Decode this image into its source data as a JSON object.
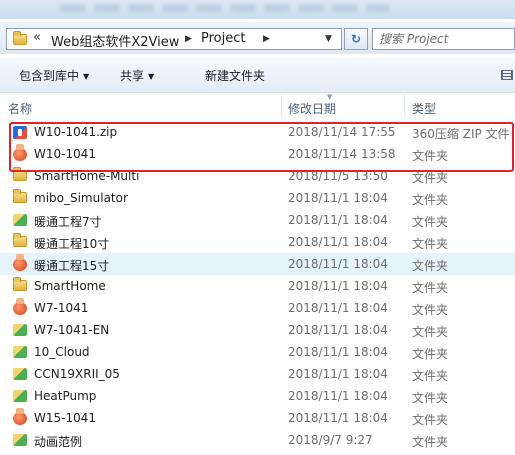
{
  "address": {
    "chevron": "«",
    "crumbs": [
      "Web组态软件X2View",
      "Project"
    ],
    "search_placeholder": "搜索 Project"
  },
  "toolbar": {
    "include_label": "包含到库中",
    "share_label": "共享",
    "new_folder_label": "新建文件夹"
  },
  "columns": {
    "name": "名称",
    "date": "修改日期",
    "type": "类型"
  },
  "files": [
    {
      "name": "W10-1041.zip",
      "date": "2018/11/14 17:55",
      "type": "360压缩 ZIP 文件",
      "icon": "zip-icon"
    },
    {
      "name": "W10-1041",
      "date": "2018/11/14 13:58",
      "type": "文件夹",
      "icon": "lib-folder-icon"
    },
    {
      "name": "SmartHome-Multi",
      "date": "2018/11/5 13:50",
      "type": "文件夹",
      "icon": "folder-icon"
    },
    {
      "name": "mibo_Simulator",
      "date": "2018/11/1 18:04",
      "type": "文件夹",
      "icon": "folder-icon"
    },
    {
      "name": "暖通工程7寸",
      "date": "2018/11/1 18:04",
      "type": "文件夹",
      "icon": "green-folder-icon"
    },
    {
      "name": "暖通工程10寸",
      "date": "2018/11/1 18:04",
      "type": "文件夹",
      "icon": "folder-icon"
    },
    {
      "name": "暖通工程15寸",
      "date": "2018/11/1 18:04",
      "type": "文件夹",
      "icon": "lib-folder-icon"
    },
    {
      "name": "SmartHome",
      "date": "2018/11/1 18:04",
      "type": "文件夹",
      "icon": "folder-icon"
    },
    {
      "name": "W7-1041",
      "date": "2018/11/1 18:04",
      "type": "文件夹",
      "icon": "lib-folder-icon"
    },
    {
      "name": "W7-1041-EN",
      "date": "2018/11/1 18:04",
      "type": "文件夹",
      "icon": "green-folder-icon"
    },
    {
      "name": "10_Cloud",
      "date": "2018/11/1 18:04",
      "type": "文件夹",
      "icon": "green-folder-icon"
    },
    {
      "name": "CCN19XRII_05",
      "date": "2018/11/1 18:04",
      "type": "文件夹",
      "icon": "green-folder-icon"
    },
    {
      "name": "HeatPump",
      "date": "2018/11/1 18:04",
      "type": "文件夹",
      "icon": "green-folder-icon"
    },
    {
      "name": "W15-1041",
      "date": "2018/11/1 18:04",
      "type": "文件夹",
      "icon": "lib-folder-icon"
    },
    {
      "name": "动画范例",
      "date": "2018/9/7 9:27",
      "type": "文件夹",
      "icon": "green-folder-icon"
    }
  ],
  "colors": {
    "highlight_box": "#e2202a",
    "hover_row": "#e5f3fb"
  }
}
